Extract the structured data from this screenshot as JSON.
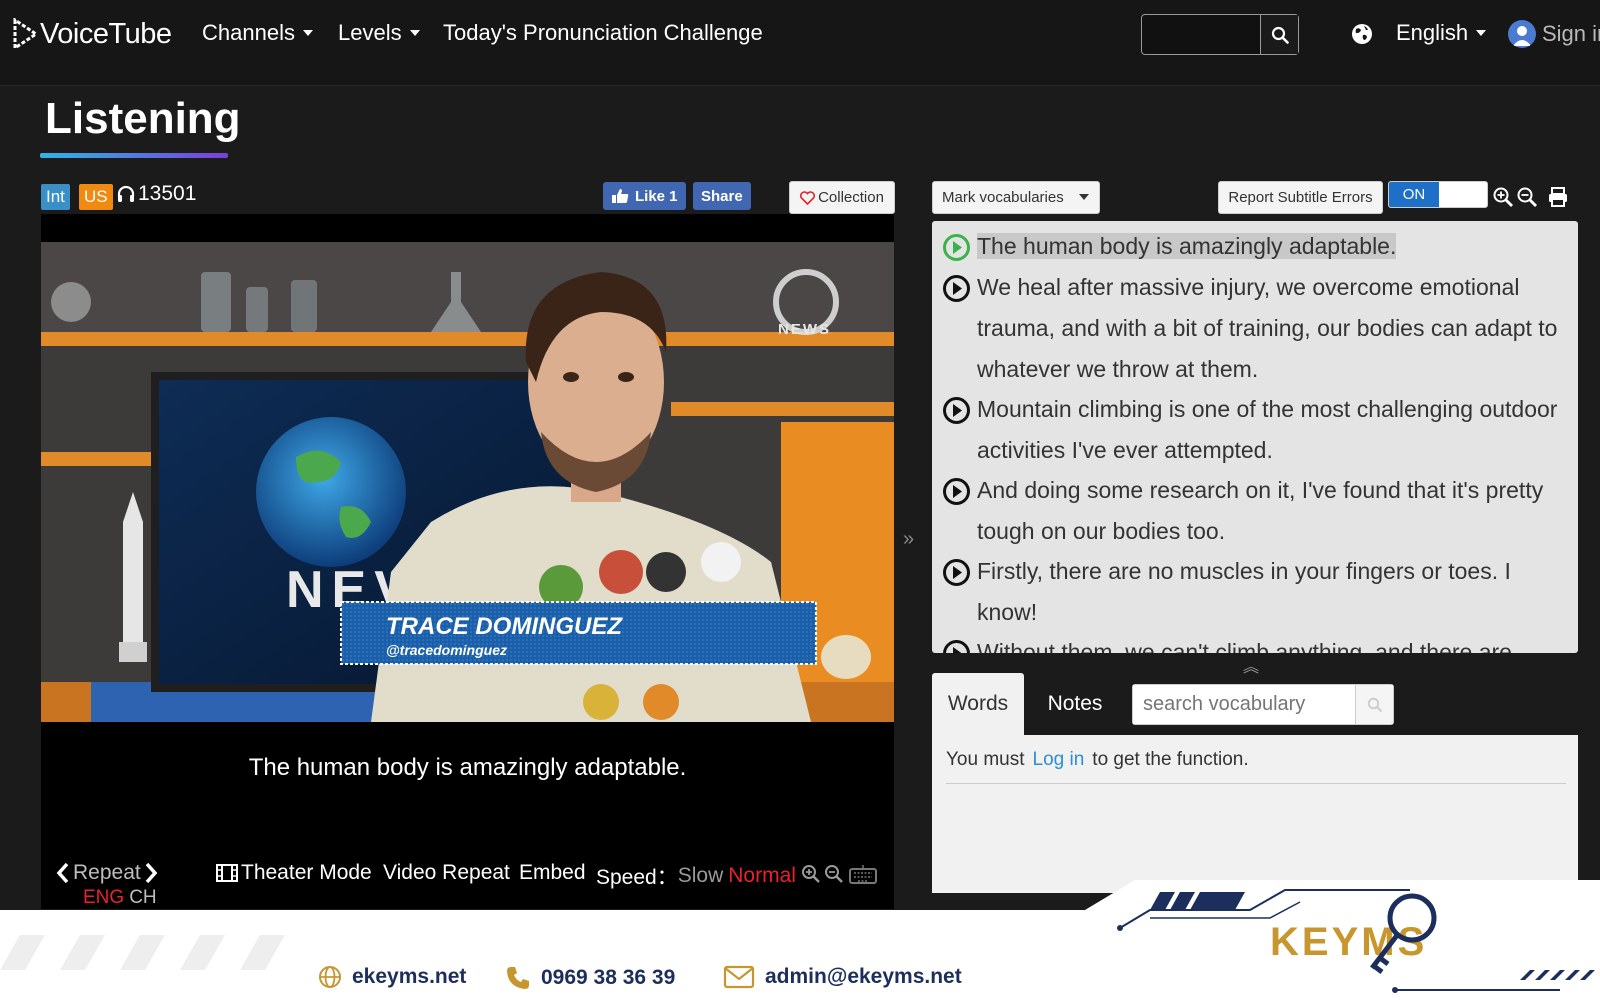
{
  "nav": {
    "brand": "VoiceTube",
    "channels": "Channels",
    "levels": "Levels",
    "challenge": "Today's Pronunciation Challenge",
    "language": "English",
    "signin": "Sign in"
  },
  "page": {
    "title": "Listening"
  },
  "video": {
    "level_badge": "Int",
    "accent_badge": "US",
    "views": "13501",
    "like_label": "Like 1",
    "share_label": "Share",
    "collection_label": "Collection",
    "current_caption": "The human body is amazingly adaptable.",
    "lower_third_name": "TRACE DOMINGUEZ",
    "lower_third_handle": "@tracedominguez",
    "channel_logo": "NEWS"
  },
  "controls": {
    "repeat": "Repeat",
    "eng": "ENG",
    "ch": "CH",
    "theater": "Theater Mode",
    "video_repeat": "Video Repeat",
    "embed": "Embed",
    "speed_label": "Speed：",
    "speed_slow": "Slow",
    "speed_normal": "Normal"
  },
  "subtitles_panel": {
    "mark_vocab": "Mark vocabularies",
    "report": "Report Subtitle Errors",
    "toggle": "ON",
    "lines": [
      "The human body is amazingly adaptable.",
      "We heal after massive injury, we overcome emotional trauma, and with a bit of training, our bodies can adapt to whatever we throw at them.",
      "Mountain climbing is one of the most challenging outdoor activities I've ever attempted.",
      "And doing some research on it, I've found that it's pretty tough on our bodies too.",
      "Firstly, there are no muscles in your fingers or toes. I know!",
      "Without them, we can't climb anything, and there are"
    ]
  },
  "words_panel": {
    "tab_words": "Words",
    "tab_notes": "Notes",
    "search_placeholder": "search vocabulary",
    "msg_before": "You must",
    "login": "Log in",
    "msg_after": "to get the function."
  },
  "footer": {
    "website": "ekeyms.net",
    "phone": "0969 38 36 39",
    "email": "admin@ekeyms.net",
    "brand": "KEYMS"
  },
  "colors": {
    "accent_blue": "#2a8ed8",
    "speed_active": "#e8232a",
    "eng_active": "#e8232a",
    "footer_navy": "#1c2e5c",
    "footer_gold": "#c8962e"
  }
}
